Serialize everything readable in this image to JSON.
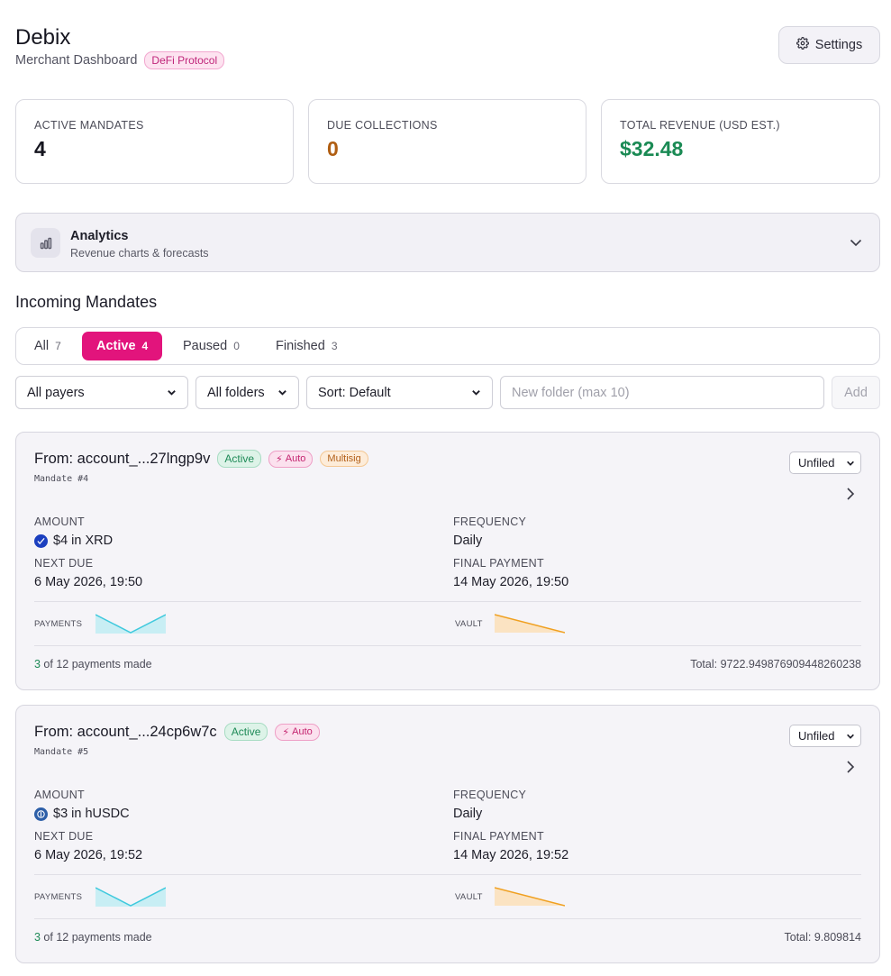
{
  "header": {
    "title": "Debix",
    "subtitle": "Merchant Dashboard",
    "badge": "DeFi Protocol",
    "settings_label": "Settings"
  },
  "stats": [
    {
      "label": "ACTIVE MANDATES",
      "value": "4",
      "color": "#15151f"
    },
    {
      "label": "DUE COLLECTIONS",
      "value": "0",
      "color": "#b05e12"
    },
    {
      "label": "TOTAL REVENUE (USD EST.)",
      "value": "$32.48",
      "color": "#1a8a54"
    }
  ],
  "analytics": {
    "title": "Analytics",
    "subtitle": "Revenue charts & forecasts"
  },
  "section_title": "Incoming Mandates",
  "tabs": [
    {
      "label": "All",
      "count": "7"
    },
    {
      "label": "Active",
      "count": "4",
      "selected": true
    },
    {
      "label": "Paused",
      "count": "0"
    },
    {
      "label": "Finished",
      "count": "3"
    }
  ],
  "filters": {
    "payers": "All payers",
    "folders": "All folders",
    "sort": "Sort: Default",
    "folder_placeholder": "New folder (max 10)",
    "add_label": "Add"
  },
  "mandates": [
    {
      "from": "From: account_...27lngp9v",
      "status": "Active",
      "auto": "Auto",
      "multisig": "Multisig",
      "id": "Mandate #4",
      "folder": "Unfiled",
      "amount_label": "AMOUNT",
      "amount": "$4 in XRD",
      "token_icon": "xrd-token-icon",
      "frequency_label": "FREQUENCY",
      "frequency": "Daily",
      "next_due_label": "NEXT DUE",
      "next_due": "6 May 2026, 19:50",
      "final_label": "FINAL PAYMENT",
      "final": "14 May 2026, 19:50",
      "payments_label": "PAYMENTS",
      "vault_label": "VAULT",
      "payments_made": "3",
      "payments_text": " of 12 payments made",
      "total": "Total: 9722.949876909448260238"
    },
    {
      "from": "From: account_...24cp6w7c",
      "status": "Active",
      "auto": "Auto",
      "id": "Mandate #5",
      "folder": "Unfiled",
      "amount_label": "AMOUNT",
      "amount": "$3 in hUSDC",
      "token_icon": "husdc-token-icon",
      "frequency_label": "FREQUENCY",
      "frequency": "Daily",
      "next_due_label": "NEXT DUE",
      "next_due": "6 May 2026, 19:52",
      "final_label": "FINAL PAYMENT",
      "final": "14 May 2026, 19:52",
      "payments_label": "PAYMENTS",
      "vault_label": "VAULT",
      "payments_made": "3",
      "payments_text": " of 12 payments made",
      "total": "Total: 9.809814"
    }
  ],
  "colors": {
    "accent": "#e2147c",
    "payments_spark": "#3fc9dd",
    "vault_spark": "#f0a020"
  }
}
